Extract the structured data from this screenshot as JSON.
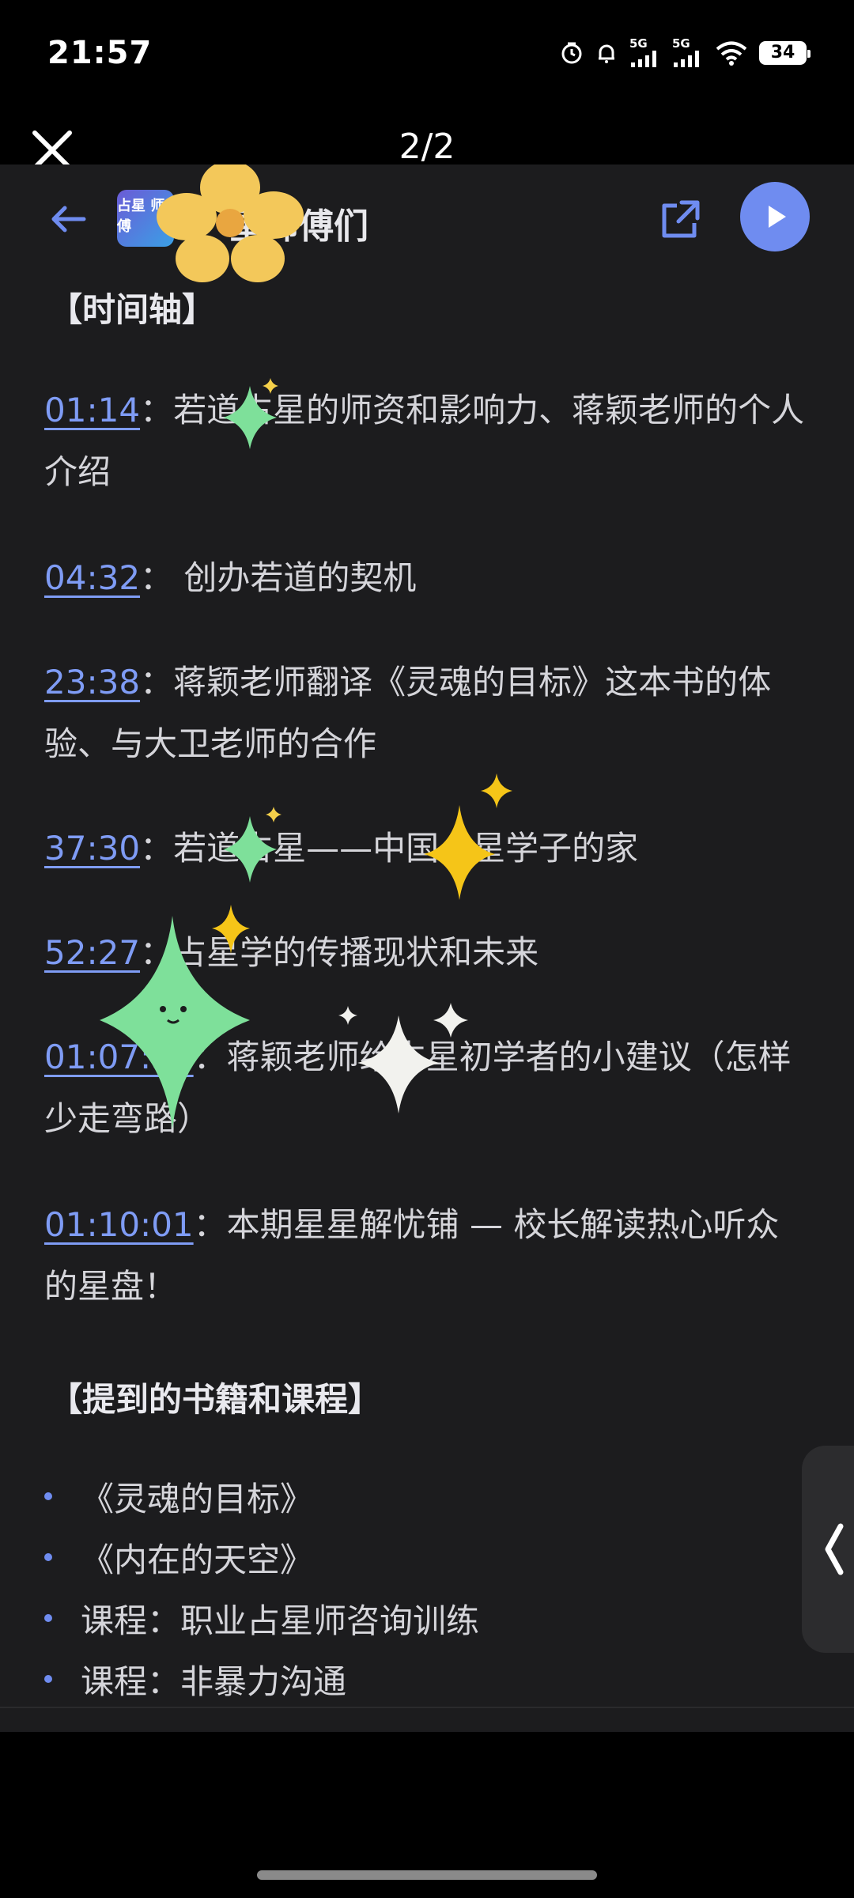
{
  "status_bar": {
    "time": "21:57",
    "network1": "5G",
    "network2": "5G",
    "battery": "34"
  },
  "viewer": {
    "page_indicator": "2/2"
  },
  "app": {
    "logo_text": "占星 师傅",
    "title": "星师傅们"
  },
  "timeline": {
    "heading": "【时间轴】",
    "entries": [
      {
        "time": "01:14",
        "sep": "：",
        "text": "若道占星的师资和影响力、蒋颖老师的个人介绍"
      },
      {
        "time": "04:32",
        "sep": "：",
        "text": " 创办若道的契机"
      },
      {
        "time": "23:38",
        "sep": "：",
        "text": "蒋颖老师翻译《灵魂的目标》这本书的体验、与大卫老师的合作"
      },
      {
        "time": "37:30",
        "sep": "：",
        "text": "若道占星——中国占星学子的家"
      },
      {
        "time": "52:27",
        "sep": "：",
        "text": "占星学的传播现状和未来"
      },
      {
        "time": "01:07:39",
        "sep": "：",
        "text": "蒋颖老师给占星初学者的小建议（怎样少走弯路）"
      },
      {
        "time": "01:10:01",
        "sep": "：",
        "text": "本期星星解忧铺 — 校长解读热心听众的星盘！"
      }
    ]
  },
  "books": {
    "heading": "【提到的书籍和课程】",
    "items": [
      "《灵魂的目标》",
      "《内在的天空》",
      "课程：职业占星师咨询训练",
      "课程：非暴力沟通"
    ]
  },
  "colors": {
    "accent": "#7f9cf5",
    "panel_bg": "#1c1c1e",
    "text": "#d5d5da"
  }
}
